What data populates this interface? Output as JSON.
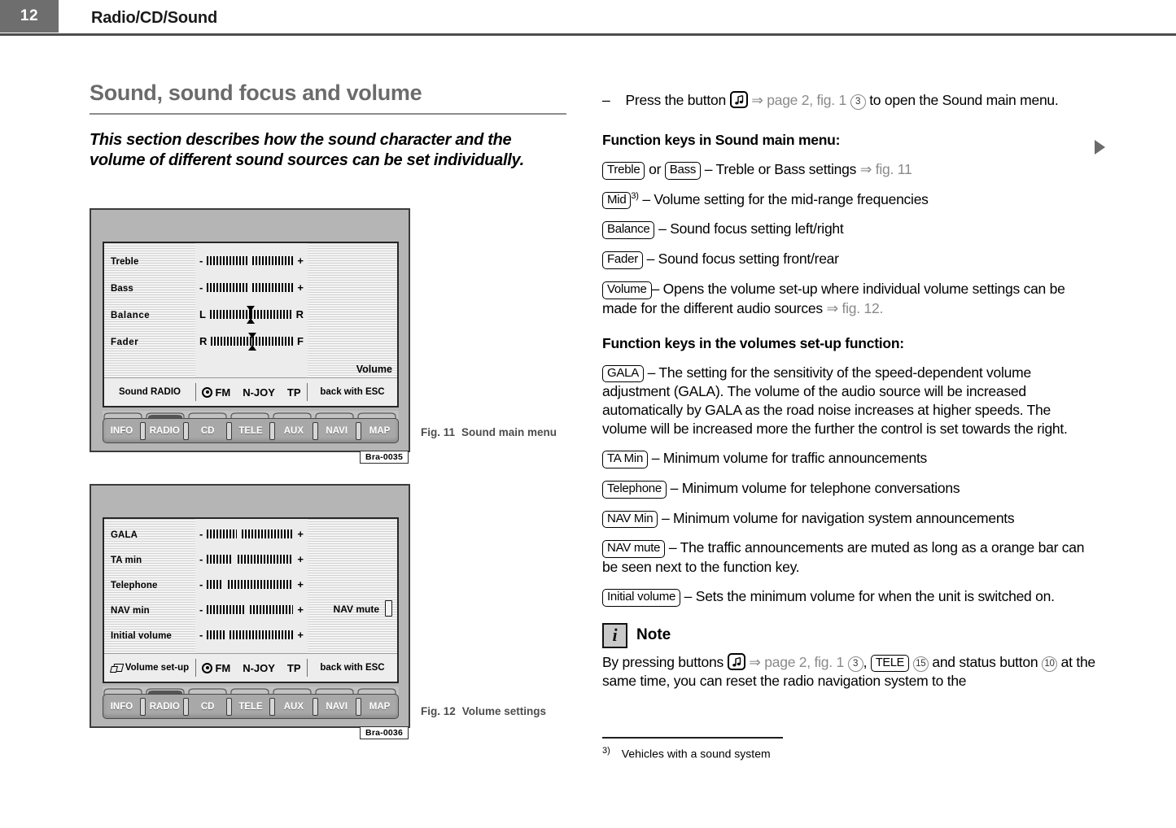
{
  "header": {
    "page_number": "12",
    "title": "Radio/CD/Sound"
  },
  "left": {
    "section_title": "Sound, sound focus and volume",
    "section_intro": "This section describes how the sound character and the volume of different sound sources can be set individually."
  },
  "fig11": {
    "code": "Bra-0035",
    "caption_num": "Fig. 11",
    "caption_text": "Sound main menu",
    "rows": [
      {
        "label": "Treble",
        "type": "plusminus",
        "left_cap": "-",
        "right_cap": "+"
      },
      {
        "label": "Bass",
        "type": "plusminus",
        "left_cap": "-",
        "right_cap": "+"
      },
      {
        "label": "Balance",
        "type": "marker",
        "left_cap": "L",
        "right_cap": "R"
      },
      {
        "label": "Fader",
        "type": "marker",
        "left_cap": "R",
        "right_cap": "F"
      }
    ],
    "right_label": "Volume",
    "status": {
      "left": "Sound RADIO",
      "band": "FM",
      "station": "N-JOY",
      "tp": "TP",
      "right": "back with ESC"
    },
    "buttons": [
      "INFO",
      "RADIO",
      "CD",
      "TELE",
      "AUX",
      "NAVI",
      "MAP"
    ]
  },
  "fig12": {
    "code": "Bra-0036",
    "caption_num": "Fig. 12",
    "caption_text": "Volume settings",
    "rows": [
      {
        "label": "GALA",
        "left_cap": "-",
        "right_cap": "+"
      },
      {
        "label": "TA min",
        "left_cap": "-",
        "right_cap": "+"
      },
      {
        "label": "Telephone",
        "left_cap": "-",
        "right_cap": "+"
      },
      {
        "label": "NAV min",
        "left_cap": "-",
        "right_cap": "+"
      },
      {
        "label": "Initial volume",
        "left_cap": "-",
        "right_cap": "+"
      }
    ],
    "nav_mute_label": "NAV mute",
    "status": {
      "left": "Volume set-up",
      "band": "FM",
      "station": "N-JOY",
      "tp": "TP",
      "right": "back with ESC"
    },
    "buttons": [
      "INFO",
      "RADIO",
      "CD",
      "TELE",
      "AUX",
      "NAVI",
      "MAP"
    ]
  },
  "right": {
    "intro_dash": "–",
    "intro_a": "Press the button",
    "intro_ref": "page 2, fig. 1",
    "intro_circle": "3",
    "intro_b": "to open the Sound main menu.",
    "heading_sound": "Function keys in Sound main menu:",
    "sound_keys": [
      {
        "key": "Treble",
        "joiner": "or",
        "key2": "Bass",
        "desc": "– Treble or Bass settings",
        "ref": "fig. 11"
      },
      {
        "key": "Mid",
        "sup": "3)",
        "desc": "– Volume setting for the mid-range frequencies"
      },
      {
        "key": "Balance",
        "desc": "– Sound focus setting left/right"
      },
      {
        "key": "Fader",
        "desc": "– Sound focus setting front/rear"
      },
      {
        "key": "Volume",
        "desc": "– Opens the volume set-up where individual volume settings can be made for the different audio sources",
        "ref": "fig. 12."
      }
    ],
    "heading_volumes": "Function keys in the volumes set-up function:",
    "volume_keys": [
      {
        "key": "GALA",
        "desc": "– The setting for the sensitivity of the speed-dependent volume adjustment (GALA). The volume of the audio source will be increased automatically by GALA as the road noise increases at higher speeds. The volume will be increased more the further the control is set towards the right."
      },
      {
        "key": "TA Min",
        "desc": "– Minimum volume for traffic announcements"
      },
      {
        "key": "Telephone",
        "desc": "– Minimum volume for telephone conversations"
      },
      {
        "key": "NAV Min",
        "desc": "– Minimum volume for navigation system announcements"
      },
      {
        "key": "NAV mute",
        "desc": "– The traffic announcements are muted as long as a orange bar can be seen next to the function key."
      },
      {
        "key": "Initial volume",
        "desc": "– Sets the minimum volume for when the unit is switched on."
      }
    ],
    "note": {
      "icon_glyph": "i",
      "title": "Note",
      "text_a": "By pressing buttons",
      "ref": "page 2, fig. 1",
      "circle_3": "3",
      "comma": ",",
      "key_tele": "TELE",
      "circle_15": "15",
      "text_b": "and status button",
      "circle_10": "10",
      "text_c": "at the same time, you can reset the radio navigation system to the"
    },
    "footnote_mark": "3)",
    "footnote_text": "Vehicles with a sound system"
  },
  "colors": {
    "header_block": "#6e6e6e",
    "title_gray": "#6b6b6b",
    "ref_gray": "#8a8a8a",
    "bezel": "#b5b5b5",
    "screen": "#e9e9e9"
  }
}
